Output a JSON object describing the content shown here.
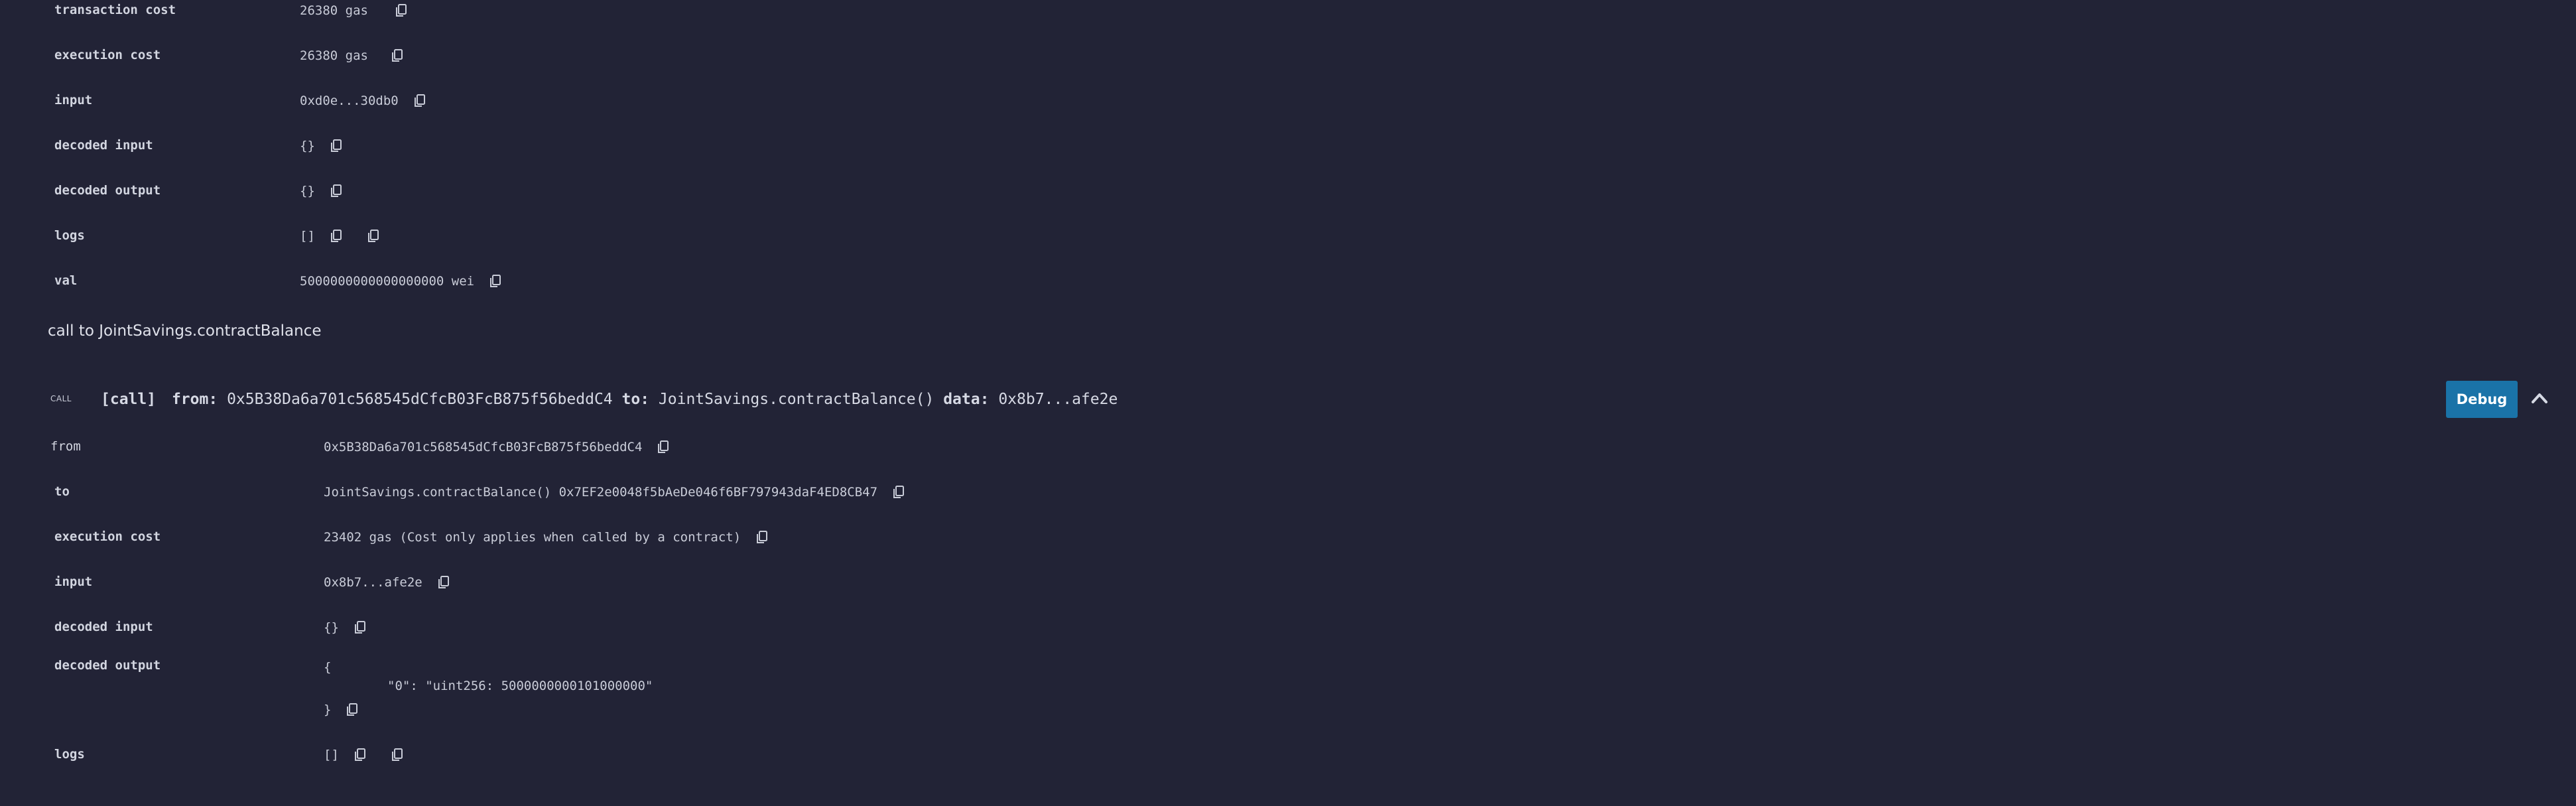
{
  "top_tx": {
    "rows": [
      {
        "key": "transaction cost",
        "value": "26380 gas"
      },
      {
        "key": "execution cost",
        "value": "26380 gas"
      },
      {
        "key": "input",
        "value": "0xd0e...30db0"
      },
      {
        "key": "decoded input",
        "value": "{}"
      },
      {
        "key": "decoded output",
        "value": "{}"
      },
      {
        "key": "logs",
        "value": "[]"
      },
      {
        "key": "val",
        "value": "5000000000000000000 wei"
      }
    ]
  },
  "call_title": "call to JointSavings.contractBalance",
  "call": {
    "tag": "CALL",
    "header": {
      "kind": "[call]",
      "from_label": "from:",
      "from_value": "0x5B38Da6a701c568545dCfcB03FcB875f56beddC4",
      "to_label": "to:",
      "to_value": "JointSavings.contractBalance()",
      "data_label": "data:",
      "data_value": "0x8b7...afe2e"
    },
    "debug_label": "Debug",
    "rows": [
      {
        "key": "from",
        "value": "0x5B38Da6a701c568545dCfcB03FcB875f56beddC4"
      },
      {
        "key": "to",
        "value": "JointSavings.contractBalance() 0x7EF2e0048f5bAeDe046f6BF797943daF4ED8CB47"
      },
      {
        "key": "execution cost",
        "value": "23402 gas (Cost only applies when called by a contract)"
      },
      {
        "key": "input",
        "value": "0x8b7...afe2e"
      },
      {
        "key": "decoded input",
        "value": "{}"
      },
      {
        "key": "decoded output",
        "value": ""
      },
      {
        "key": "logs",
        "value": "[]"
      }
    ],
    "decoded_output": {
      "open": "{",
      "line": "\"0\": \"uint256: 5000000000101000000\"",
      "close": "}"
    }
  },
  "colors": {
    "background": "#222336",
    "debug_button": "#1a73a8",
    "text": "#c9ccd8"
  },
  "icons": {
    "copy": "copy-icon",
    "collapse": "chevron-up-icon"
  }
}
